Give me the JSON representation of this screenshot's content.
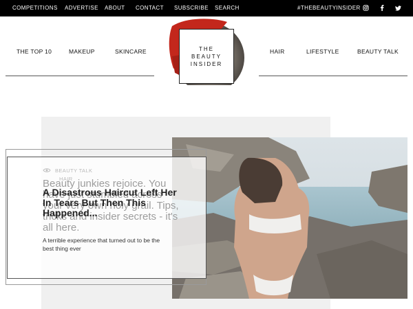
{
  "topbar": {
    "links": [
      "COMPETITIONS",
      "ADVERTISE",
      "ABOUT",
      "CONTACT",
      "SUBSCRIBE",
      "SEARCH"
    ],
    "hashtag": "#THEBEAUTYINSIDER",
    "social": [
      {
        "icon": "instagram-icon",
        "glyph": "◎"
      },
      {
        "icon": "facebook-icon",
        "glyph": "f"
      },
      {
        "icon": "twitter-icon",
        "glyph": "🐦"
      }
    ]
  },
  "nav": {
    "left": [
      "THE TOP 10",
      "MAKEUP",
      "SKINCARE"
    ],
    "right": [
      "HAIR",
      "LIFESTYLE",
      "BEAUTY TALK"
    ]
  },
  "logo": {
    "line1": "THE",
    "line2": "BEAUTY",
    "line3": "INSIDER",
    "accent": "#c3271c"
  },
  "hero": {
    "category_1": "BEAUTY TALK",
    "category_2": "HAIR",
    "ghost_title": "Beauty junkies rejoice. You have just stumbled across your very own holy grail. Tips, tricks and insider secrets - it's all here.",
    "title": "A Disastrous Haircut Left Her In Tears But Then This Happened...",
    "excerpt": "A terrible experience that turned out to be the best thing ever"
  }
}
